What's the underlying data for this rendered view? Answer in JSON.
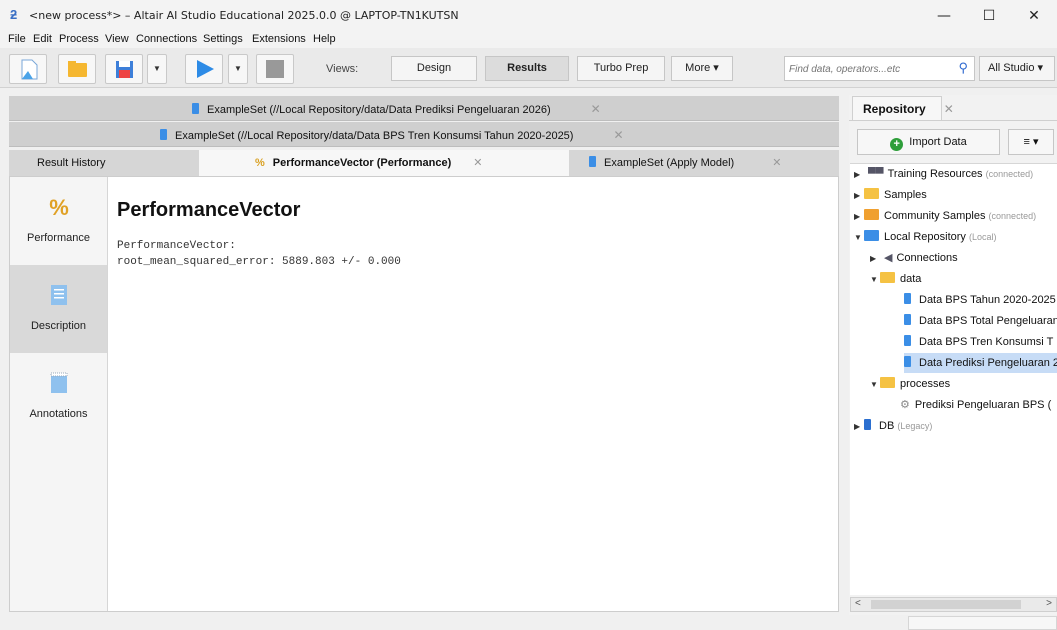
{
  "window": {
    "title": "<new process*> – Altair AI Studio Educational 2025.0.0 @ LAPTOP-TN1KUTSN",
    "minimize": "—",
    "maximize": "☐",
    "close": "✕"
  },
  "menu": [
    "File",
    "Edit",
    "Process",
    "View",
    "Connections",
    "Settings",
    "Extensions",
    "Help"
  ],
  "toolbar": {
    "views_label": "Views:",
    "views": [
      "Design",
      "Results",
      "Turbo Prep",
      "More ▾"
    ],
    "search_placeholder": "Find data, operators...etc",
    "perspective": "All Studio ▾"
  },
  "doc_tabs": [
    "ExampleSet (//Local Repository/data/Data Prediksi Pengeluaran 2026)",
    "ExampleSet (//Local Repository/data/Data BPS Tren Konsumsi Tahun 2020-2025)"
  ],
  "result_tabs": {
    "history": "Result History",
    "performance": "PerformanceVector (Performance)",
    "apply_model": "ExampleSet (Apply Model)"
  },
  "sidebar": [
    "Performance",
    "Description",
    "Annotations"
  ],
  "main": {
    "heading": "PerformanceVector",
    "line1": "PerformanceVector:",
    "line2": "root_mean_squared_error: 5889.803 +/- 0.000"
  },
  "repository": {
    "tab": "Repository",
    "import": "Import Data",
    "menu": "≡ ▾",
    "tree": [
      {
        "label": "Training Resources",
        "sub": "(connected)"
      },
      {
        "label": "Samples",
        "sub": ""
      },
      {
        "label": "Community Samples",
        "sub": "(connected)"
      },
      {
        "label": "Local Repository",
        "sub": "(Local)"
      },
      {
        "label": "Connections",
        "sub": ""
      },
      {
        "label": "data",
        "sub": ""
      },
      {
        "label": "Data BPS Tahun 2020-2025",
        "sub": ""
      },
      {
        "label": "Data BPS Total Pengeluaran",
        "sub": ""
      },
      {
        "label": "Data BPS Tren Konsumsi T",
        "sub": ""
      },
      {
        "label": "Data Prediksi Pengeluaran 2",
        "sub": ""
      },
      {
        "label": "processes",
        "sub": ""
      },
      {
        "label": "Prediksi Pengeluaran BPS (",
        "sub": ""
      },
      {
        "label": "DB",
        "sub": "(Legacy)"
      }
    ]
  },
  "colors": {
    "accent_blue": "#3b8ee6",
    "folder": "#f5c243",
    "selection": "#c7dcf6"
  }
}
